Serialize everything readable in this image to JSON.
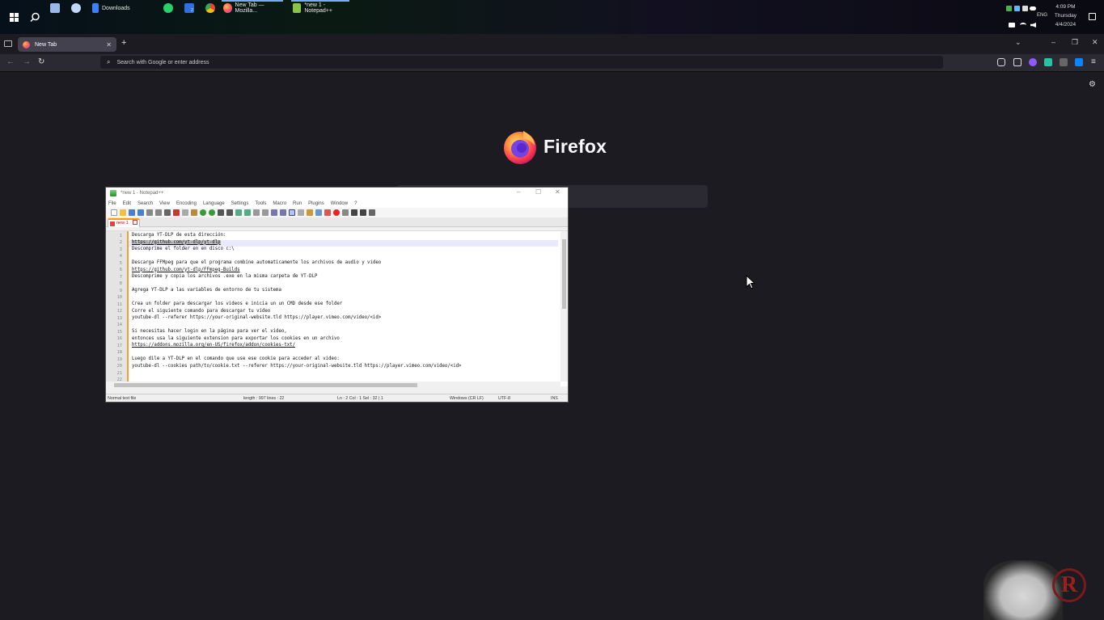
{
  "taskbar": {
    "apps": [
      {
        "label": "Downloads",
        "active": false
      },
      {
        "label": "New Tab — Mozilla...",
        "active": true
      },
      {
        "label": "*new 1 - Notepad++",
        "active": true
      }
    ],
    "badge_count": "2",
    "lang": "ENG",
    "time": "4:09 PM",
    "day": "Thursday",
    "date": "4/4/2024"
  },
  "browser": {
    "tab_title": "New Tab",
    "url_placeholder": "Search with Google or enter address",
    "brand": "Firefox"
  },
  "notepad": {
    "title": "*new 1 - Notepad++",
    "menu": [
      "File",
      "Edit",
      "Search",
      "View",
      "Encoding",
      "Language",
      "Settings",
      "Tools",
      "Macro",
      "Run",
      "Plugins",
      "Window",
      "?"
    ],
    "tab_label": "new 1",
    "lines": [
      {
        "n": "1",
        "text": "Descarga YT-DLP de esta dirección:",
        "link": false,
        "selected": false
      },
      {
        "n": "2",
        "text": "https://github.com/yt-dlp/yt-dlp",
        "link": true,
        "selected": true
      },
      {
        "n": "3",
        "text": "Descomprime el folder en en disco c:\\",
        "link": false,
        "selected": false
      },
      {
        "n": "4",
        "text": "",
        "link": false,
        "selected": false
      },
      {
        "n": "5",
        "text": "Descarga FFMpeg para que el programa combine automaticamente los archivos de audio y video",
        "link": false,
        "selected": false
      },
      {
        "n": "6",
        "text": "https://github.com/yt-dlp/FFmpeg-Builds",
        "link": true,
        "selected": false
      },
      {
        "n": "7",
        "text": "Descomprime y copia los archivos .exe en la misma carpeta de YT-DLP",
        "link": false,
        "selected": false
      },
      {
        "n": "8",
        "text": "",
        "link": false,
        "selected": false
      },
      {
        "n": "9",
        "text": "Agrega YT-DLP a las variables de entorno de tu sistema",
        "link": false,
        "selected": false
      },
      {
        "n": "10",
        "text": "",
        "link": false,
        "selected": false
      },
      {
        "n": "11",
        "text": "Crea un folder para descargar los videos e inicia un un CMD desde ese folder",
        "link": false,
        "selected": false
      },
      {
        "n": "12",
        "text": "Corre el siguiente comando para descargar tu video",
        "link": false,
        "selected": false
      },
      {
        "n": "13",
        "text": "youtube-dl --referer https://your-original-website.tld https://player.vimeo.com/video/<id>",
        "link": false,
        "selected": false
      },
      {
        "n": "14",
        "text": "",
        "link": false,
        "selected": false
      },
      {
        "n": "15",
        "text": "Si necesitas hacer login en la página para ver el video,",
        "link": false,
        "selected": false
      },
      {
        "n": "16",
        "text": "entonces usa la siguiente extension para exportar los cookies en un archivo",
        "link": false,
        "selected": false
      },
      {
        "n": "17",
        "text": "https://addons.mozilla.org/en-US/firefox/addon/cookies-txt/",
        "link": true,
        "selected": false
      },
      {
        "n": "18",
        "text": "",
        "link": false,
        "selected": false
      },
      {
        "n": "19",
        "text": "Luego dile a YT-DLP en el comando que use ese cookie para acceder al video:",
        "link": false,
        "selected": false
      },
      {
        "n": "20",
        "text": "youtube-dl --cookies path/to/cookie.txt --referer https://your-original-website.tld https://player.vimeo.com/video/<id>",
        "link": false,
        "selected": false
      },
      {
        "n": "21",
        "text": "",
        "link": false,
        "selected": false
      },
      {
        "n": "22",
        "text": "",
        "link": false,
        "selected": false
      }
    ],
    "status": {
      "type": "Normal text file",
      "length": "length : 997    lines : 22",
      "position": "Ln : 2    Col : 1    Sel : 32 | 1",
      "eol": "Windows (CR LF)",
      "encoding": "UTF-8",
      "mode": "INS"
    }
  },
  "colors": {
    "page_bg": "#1c1b22",
    "toolbar_bg": "#2b2a33",
    "gutter_accent": "#f0a030"
  }
}
